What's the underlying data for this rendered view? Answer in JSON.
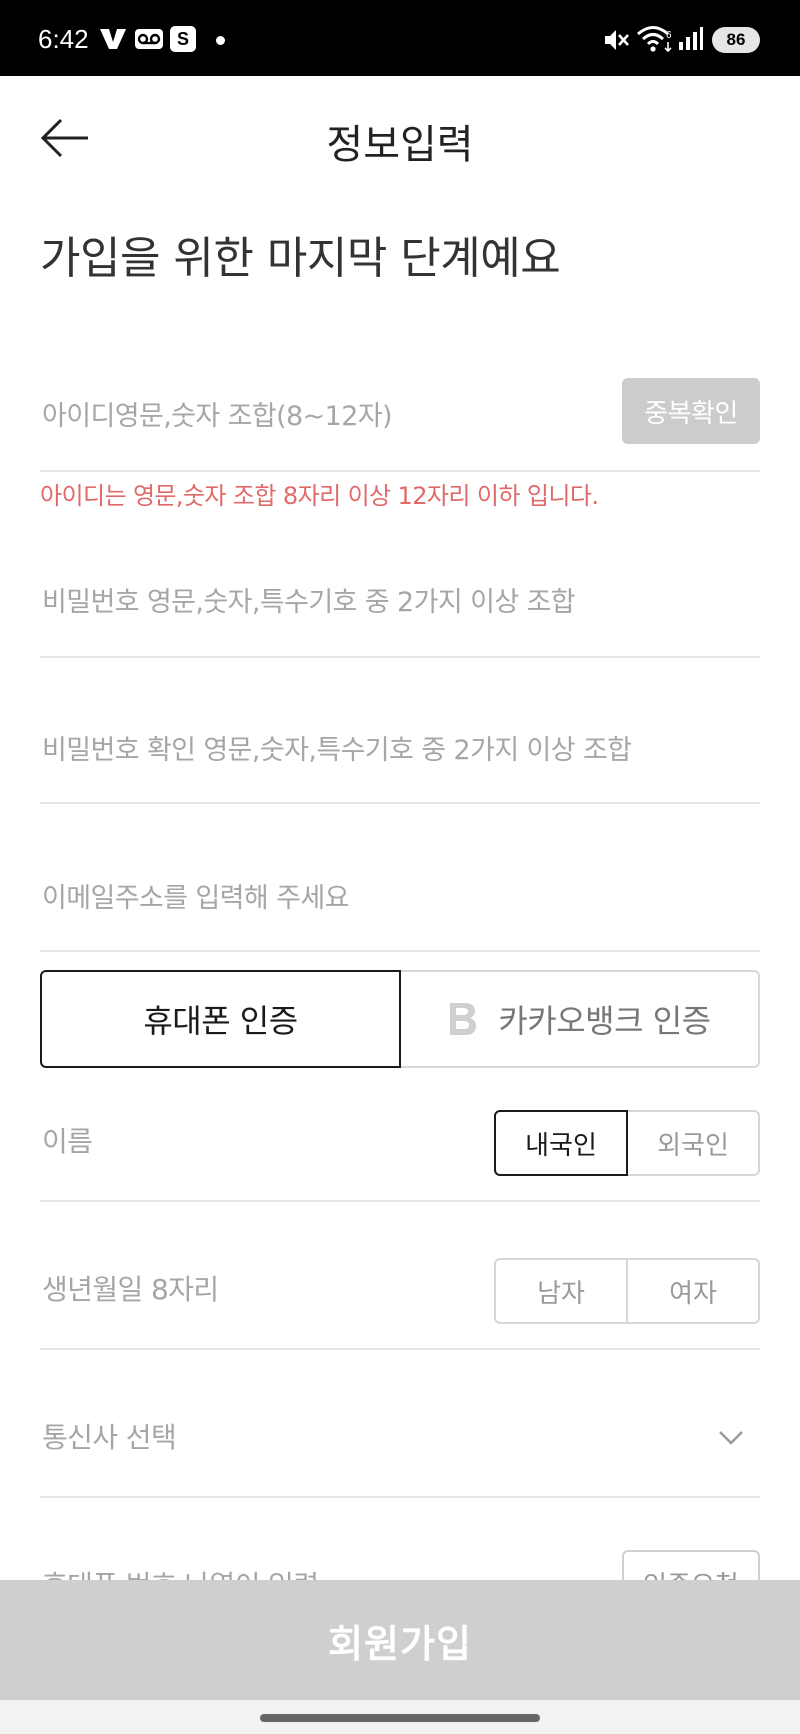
{
  "status_bar": {
    "time": "6:42",
    "notification_icons": [
      "v-app-icon",
      "voicemail-icon",
      "s-app-icon"
    ],
    "notif3_letter": "S",
    "battery": "86"
  },
  "header": {
    "title": "정보입력",
    "back_icon": "arrow-left-icon"
  },
  "heading": "가입을 위한 마지막 단계예요",
  "form": {
    "id_placeholder": "아이디영문,숫자 조합(8~12자)",
    "dup_check_label": "중복확인",
    "id_error": "아이디는 영문,숫자 조합 8자리 이상 12자리 이하 입니다.",
    "password_placeholder": "비밀번호 영문,숫자,특수기호 중 2가지 이상 조합",
    "password_confirm_placeholder": "비밀번호 확인 영문,숫자,특수기호 중 2가지 이상 조합",
    "email_placeholder": "이메일주소를 입력해 주세요"
  },
  "auth": {
    "phone_tab": "휴대폰 인증",
    "kakaobank_tab": "카카오뱅크 인증",
    "kakaobank_icon": "kakaobank-b-icon",
    "name_placeholder": "이름",
    "nationality": {
      "domestic": "내국인",
      "foreign": "외국인",
      "selected": "내국인"
    },
    "birth_placeholder": "생년월일 8자리",
    "gender": {
      "male": "남자",
      "female": "여자"
    },
    "carrier_placeholder": "통신사 선택",
    "phone_placeholder": "휴대폰 번호 나열이 입력",
    "verify_label": "인증요청"
  },
  "submit_label": "회원가입",
  "colors": {
    "error": "#e06a6a",
    "disabled_button": "#cccccc",
    "active_border": "#1a1a1a"
  }
}
